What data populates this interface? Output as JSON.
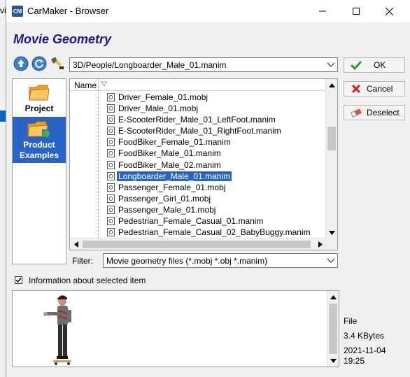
{
  "background_window": {
    "text": "vi"
  },
  "titlebar": {
    "app_icon": "CM",
    "title": "CarMaker - Browser"
  },
  "heading": "Movie Geometry",
  "toolbar": {
    "icons": [
      "up-arrow-icon",
      "refresh-icon",
      "edit-brush-icon"
    ]
  },
  "path": {
    "value": "3D/People/Longboarder_Male_01.manim"
  },
  "buttons": {
    "ok": "OK",
    "cancel": "Cancel",
    "deselect": "Deselect"
  },
  "places": [
    {
      "label": "Project",
      "selected": false
    },
    {
      "label": "Product Examples",
      "selected": true
    }
  ],
  "filelist": {
    "column_header": "Name",
    "files": [
      {
        "name": "Driver_Female_01.mobj",
        "selected": false
      },
      {
        "name": "Driver_Male_01.mobj",
        "selected": false
      },
      {
        "name": "E-ScooterRider_Male_01_LeftFoot.manim",
        "selected": false
      },
      {
        "name": "E-ScooterRider_Male_01_RightFoot.manim",
        "selected": false
      },
      {
        "name": "FoodBiker_Female_01.manim",
        "selected": false
      },
      {
        "name": "FoodBiker_Male_01.manim",
        "selected": false
      },
      {
        "name": "FoodBiker_Male_02.manim",
        "selected": false
      },
      {
        "name": "Longboarder_Male_01.manim",
        "selected": true
      },
      {
        "name": "Passenger_Female_01.mobj",
        "selected": false
      },
      {
        "name": "Passenger_Girl_01.mobj",
        "selected": false
      },
      {
        "name": "Passenger_Male_01.mobj",
        "selected": false
      },
      {
        "name": "Pedestrian_Female_Casual_01.manim",
        "selected": false
      },
      {
        "name": "Pedestrian_Female_Casual_02_BabyBuggy.manim",
        "selected": false
      }
    ]
  },
  "filter": {
    "label": "Filter:",
    "value": "Movie geometry files (*.mobj *.obj *.manim)"
  },
  "info_checkbox": {
    "label": "Information about selected item",
    "checked": true
  },
  "info": {
    "type": "File",
    "size": "3.4 KBytes",
    "date": "2021-11-04",
    "time": "19:25"
  },
  "colors": {
    "accent": "#2864c8",
    "heading": "#1a1a8c"
  }
}
